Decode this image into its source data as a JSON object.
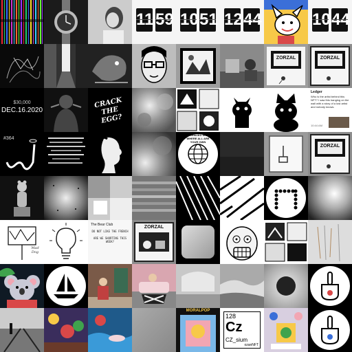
{
  "grid": {
    "columns": 8,
    "rows": 8,
    "tile_count": 64
  },
  "clocks": [
    {
      "hour": "11",
      "minute": "59"
    },
    {
      "hour": "10",
      "minute": "51"
    },
    {
      "hour": "12",
      "minute": "44"
    },
    {
      "hour": "10",
      "minute": "44"
    }
  ],
  "date_tile": {
    "amount": "$30,000",
    "date": "DEC.16.2020"
  },
  "graffiti_tile": {
    "text": "CRACK THE EGG?"
  },
  "number_tile": {
    "number": "#364"
  },
  "token_tile": {
    "number": "128",
    "symbol": "Cz",
    "name": "CZ_sium",
    "subtitle": "ozanNFT"
  },
  "sign_tile": {
    "text": "Mad Dog"
  },
  "world_badge": {
    "text": "A TOKENIZED WORLD WHERE ALL ARE YOUR OWN"
  },
  "tweet_tile": {
    "handle": "Ledger",
    "body": "Who is the artist behind this NFT? I saw this hanging on the wall with a story of a lost artist and nobody knows.",
    "footer": "10:44 AM"
  },
  "notes_tile": {
    "title": "The Bear Club",
    "line1": "DO NOT LIKE THE FRENCH",
    "line2": "ARE WE SHORTING THIS WEEK?"
  },
  "poster_label": {
    "text": "MORALPOP"
  },
  "poster_labels": [
    "ZORZAL",
    "ZORZAL",
    "ZORZAL",
    "ZORZAL"
  ],
  "colors": {
    "background": "#000000",
    "accent_yellow": "#f7c948",
    "accent_green": "#3fa34d",
    "accent_red": "#d94848",
    "accent_blue": "#3b6fd8",
    "koala_pink": "#f2a6b3"
  }
}
